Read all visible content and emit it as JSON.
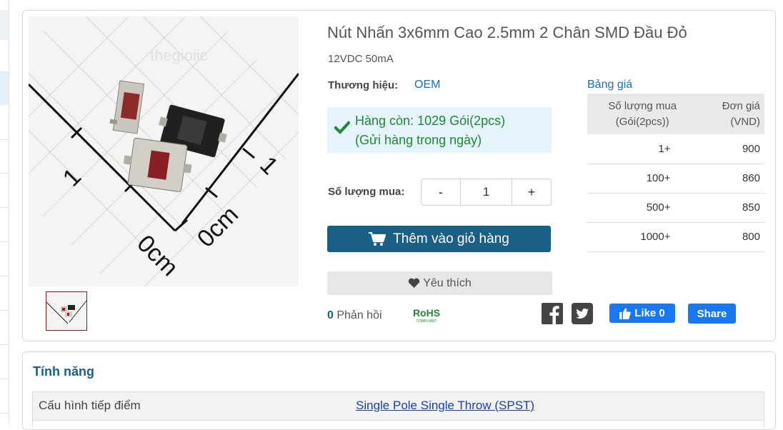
{
  "product": {
    "title": "Nút Nhấn 3x6mm Cao 2.5mm 2 Chân SMD Đầu Đỏ",
    "subtitle": "12VDC 50mA",
    "brand_label": "Thương hiệu:",
    "brand_value": "OEM",
    "image_watermark": "thegioiic"
  },
  "stock": {
    "line1": "Hàng còn: 1029 Gói(2pcs)",
    "line2": "(Gửi hàng trong ngày)",
    "icon": "check-icon"
  },
  "quantity": {
    "label": "Số lượng mua:",
    "minus": "-",
    "value": "1",
    "plus": "+"
  },
  "actions": {
    "add_to_cart": "Thêm vào giỏ hàng",
    "wishlist": "Yêu thích",
    "replies_count": "0",
    "replies_label": "Phản hồi",
    "rohs": "RoHS",
    "rohs_sub": "COMPLIANT",
    "like": "Like 0",
    "share": "Share"
  },
  "pricing": {
    "title": "Bảng giá",
    "header_qty_line1": "Số lượng mua",
    "header_qty_line2": "(Gói(2pcs))",
    "header_price_line1": "Đơn giá",
    "header_price_line2": "(VND)",
    "rows": [
      {
        "qty": "1+",
        "price": "900"
      },
      {
        "qty": "100+",
        "price": "860"
      },
      {
        "qty": "500+",
        "price": "850"
      },
      {
        "qty": "1000+",
        "price": "800"
      }
    ]
  },
  "features": {
    "title": "Tính năng",
    "rows": [
      {
        "key": "Cấu hình tiếp điểm",
        "value": "Single Pole Single Throw (SPST)"
      }
    ]
  },
  "image_labels": {
    "one_left": "1",
    "one_right": "1",
    "zero_cm_left": "0cm",
    "zero_cm_right": "0cm"
  },
  "colors": {
    "primary": "#1c5f84",
    "link": "#1a6fb5",
    "stock_green": "#1e8a2e",
    "stock_bg": "#e5f4fb",
    "facebook": "#1877f2"
  }
}
